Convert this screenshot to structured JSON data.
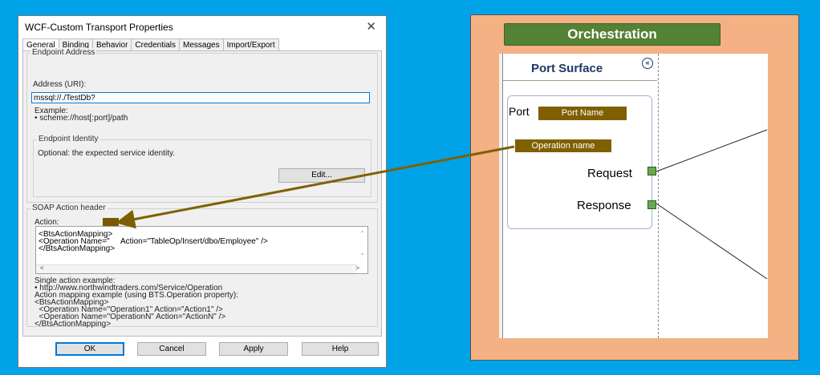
{
  "dialog": {
    "title": "WCF-Custom Transport Properties",
    "tabs": [
      "General",
      "Binding",
      "Behavior",
      "Credentials",
      "Messages",
      "Import/Export"
    ],
    "endpoint_address": {
      "group_label": "Endpoint Address",
      "address_label": "Address (URI):",
      "address_value": "mssql://./TestDb?",
      "example_line1": "Example:",
      "example_line2": "• scheme://host[:port]/path"
    },
    "endpoint_identity": {
      "group_label": "Endpoint Identity",
      "description": "Optional: the expected service identity.",
      "edit_button": "Edit..."
    },
    "soap_action": {
      "group_label": "SOAP Action header",
      "action_label": "Action:",
      "action_text": "<BtsActionMapping>\n<Operation Name=\"     Action=\"TableOp/Insert/dbo/Employee\" />\n</BtsActionMapping>",
      "help_text": "Single action example:\n• http://www.northwindtraders.com/Service/Operation\nAction mapping example (using BTS.Operation property):\n<BtsActionMapping>\n  <Operation Name=\"Operation1\" Action=\"Action1\" />\n  <Operation Name=\"OperationN\" Action=\"ActionN\" />\n</BtsActionMapping>"
    },
    "buttons": {
      "ok": "OK",
      "cancel": "Cancel",
      "apply": "Apply",
      "help": "Help"
    }
  },
  "orchestration": {
    "title": "Orchestration",
    "port_surface_title": "Port Surface",
    "collapse_glyph": "«",
    "port_label": "Port",
    "port_name_tag": "Port Name",
    "operation_name_tag": "Operation name",
    "request_label": "Request",
    "response_label": "Response"
  },
  "colors": {
    "background": "#00a2e8",
    "orchestration_frame": "#f4b183",
    "orchestration_title_bg": "#548235",
    "tag_bg": "#7f6000",
    "arrow": "#7f6000"
  },
  "icons": {
    "close": "close-icon",
    "collapse": "double-chevron-left-icon",
    "port_connector": "port-connector-icon"
  }
}
